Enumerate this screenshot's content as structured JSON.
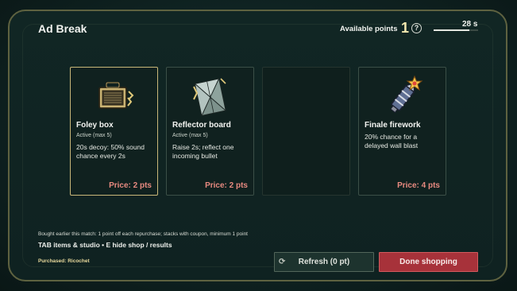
{
  "title": "Ad Break",
  "points": {
    "label": "Available points",
    "value": "1",
    "help_glyph": "?"
  },
  "timer": {
    "text": "28 s",
    "fraction_remaining": 0.8
  },
  "cards": [
    {
      "name": "Foley box",
      "status": "Active (max 5)",
      "description": "20s decoy: 50% sound chance every 2s",
      "price": "Price: 2 pts",
      "icon": "foley-box-icon",
      "selected": true
    },
    {
      "name": "Reflector board",
      "status": "Active (max 5)",
      "description": "Raise 2s; reflect one incoming bullet",
      "price": "Price: 2 pts",
      "icon": "reflector-board-icon",
      "selected": false
    },
    {
      "empty": true
    },
    {
      "name": "Finale firework",
      "status": "",
      "description": "20% chance for a delayed wall blast",
      "price": "Price: 4 pts",
      "icon": "firework-icon",
      "selected": false
    }
  ],
  "footnote": "Bought earlier this match: 1 point off each repurchase; stacks with coupon, minimum 1 point",
  "hint": "TAB items & studio • E hide shop / results",
  "purchased": "Purchased: Ricochet",
  "buttons": {
    "refresh_label": "Refresh (0 pt)",
    "done_label": "Done shopping"
  },
  "colors": {
    "accent_gold": "#c9b779",
    "price_red": "#e88a80",
    "done_red": "#a7323a",
    "frame": "#5e6240"
  }
}
